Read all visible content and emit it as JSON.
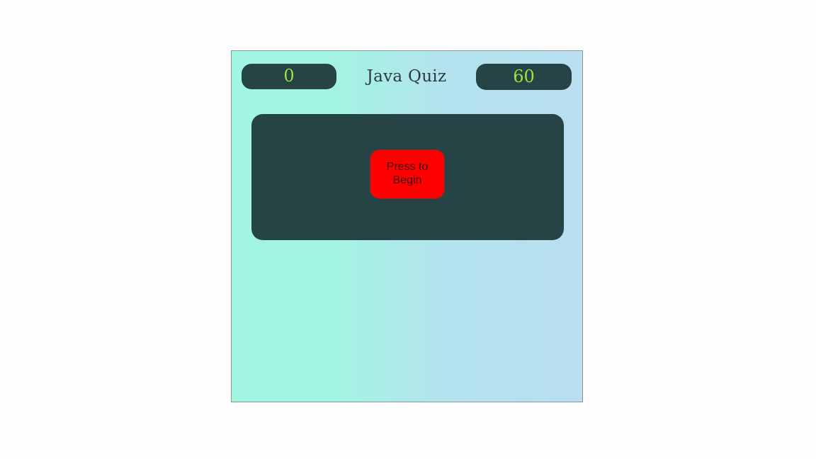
{
  "header": {
    "score": "0",
    "title": "Java Quiz",
    "timer": "60"
  },
  "panel": {
    "start_label": "Press to Begin"
  },
  "colors": {
    "panel_bg": "#264445",
    "accent_text": "#9ee33c",
    "start_button": "#ff0000",
    "gradient_left": "#a0f6e0",
    "gradient_right": "#b9def0"
  }
}
